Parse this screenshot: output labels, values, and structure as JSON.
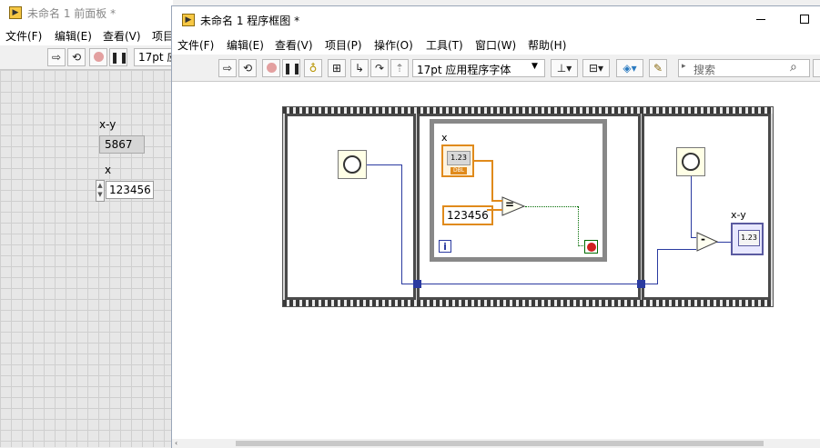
{
  "front_panel": {
    "title": "未命名 1 前面板 *",
    "menu": [
      "文件(F)",
      "编辑(E)",
      "查看(V)",
      "项目"
    ],
    "font_label": "17pt 应",
    "indicator_label": "x-y",
    "indicator_value": "5867",
    "control_label": "x",
    "control_value": "123456"
  },
  "block_diagram": {
    "title": "未命名 1 程序框图 *",
    "menu": [
      "文件(F)",
      "编辑(E)",
      "查看(V)",
      "项目(P)",
      "操作(O)",
      "工具(T)",
      "窗口(W)",
      "帮助(H)"
    ],
    "font_label": "17pt 应用程序字体",
    "search_placeholder": "搜索",
    "x_label": "x",
    "terminal_text": "1.23",
    "terminal_type": "DBL",
    "constant_value": "123456",
    "equal_symbol": "=",
    "minus_symbol": "-",
    "iteration_symbol": "i",
    "xy_label": "x-y",
    "xy_terminal_text": "1.23"
  },
  "colors": {
    "numeric_wire": "#e08a1b",
    "dbl_wire": "#2a3aa0",
    "boolean_wire": "#006b00",
    "stop_red": "#d02020"
  },
  "icons": [
    "run-arrow-icon",
    "run-continuous-icon",
    "abort-icon",
    "pause-icon",
    "highlight-bulb-icon",
    "retain-wire-icon",
    "step-into-icon",
    "step-over-icon",
    "step-out-icon",
    "align-icon",
    "distribute-icon",
    "reorder-icon",
    "cleanup-icon",
    "search-icon",
    "help-icon",
    "minimize-icon",
    "maximize-icon"
  ]
}
